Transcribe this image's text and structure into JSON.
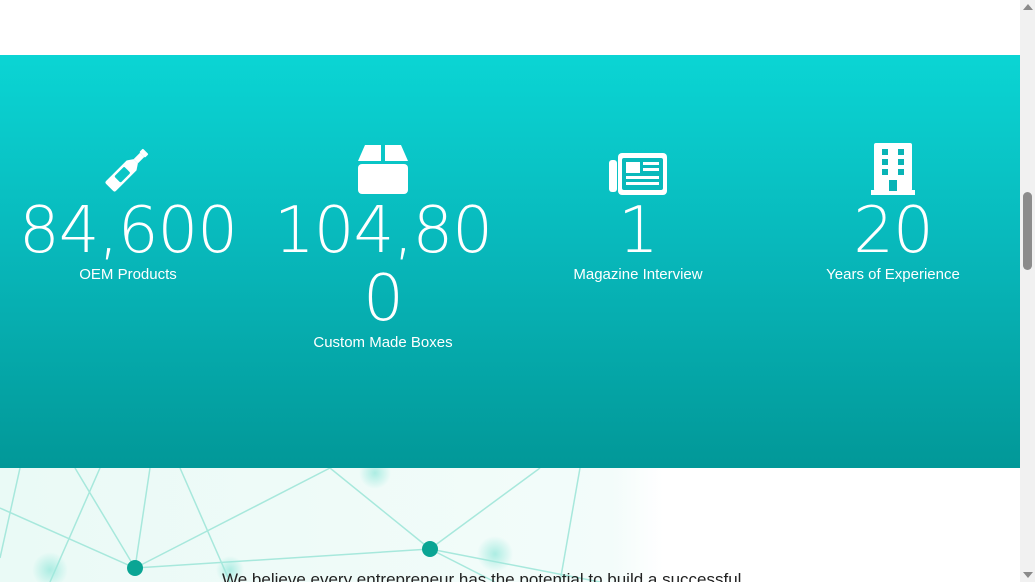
{
  "stats": [
    {
      "icon": "bottle-icon",
      "number": "84,600",
      "label": "OEM Products"
    },
    {
      "icon": "box-icon",
      "number": "104,800",
      "label": "Custom Made Boxes"
    },
    {
      "icon": "newspaper-icon",
      "number": "1",
      "label": "Magazine Interview"
    },
    {
      "icon": "building-icon",
      "number": "20",
      "label": "Years of Experience"
    }
  ],
  "intro": {
    "text": "We believe every entrepreneur has the potential to build a successful"
  },
  "colors": {
    "band_top": "#0bd5d4",
    "band_bottom": "#029898",
    "network_node": "#0aa594"
  }
}
